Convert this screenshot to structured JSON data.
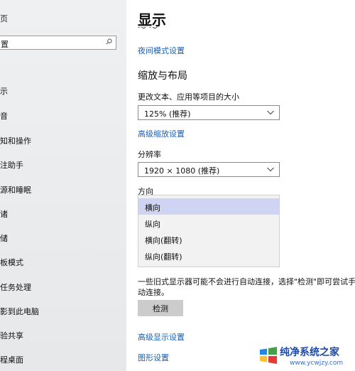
{
  "sidebar": {
    "top_partial": "页",
    "search_partial": "置",
    "items": [
      "示",
      "音",
      "知和操作",
      "注助手",
      "源和睡眠",
      "诸",
      "储",
      "板模式",
      "任务处理",
      "影到此电脑",
      "验共享",
      "程桌面"
    ]
  },
  "main": {
    "title": "显示",
    "clipped_text": "〜 〜",
    "night_link": "夜间模式设置",
    "section_title": "缩放与布局",
    "text_size_label": "更改文本、应用等项目的大小",
    "scale_value": "125% (推荐)",
    "advanced_scale_link": "高级缩放设置",
    "resolution_label": "分辨率",
    "resolution_value": "1920 × 1080 (推荐)",
    "orientation_label": "方向",
    "orientation_options": [
      "横向",
      "纵向",
      "横向(翻转)",
      "纵向(翻转)"
    ],
    "orientation_selected": "横向",
    "warning_text": "一些旧式显示器可能不会进行自动连接，选择\"检测\"即可尝试手动连接。",
    "detect_button": "检测",
    "advanced_display_link": "高级显示设置",
    "graphics_link": "图形设置"
  },
  "watermark": {
    "title": "纯净系统之家",
    "url": "www.ycwjzy.com"
  },
  "colors": {
    "link": "#1a5fb4",
    "selected_option": "#cfd4f2",
    "sidebar_bg": "#eceef0"
  }
}
